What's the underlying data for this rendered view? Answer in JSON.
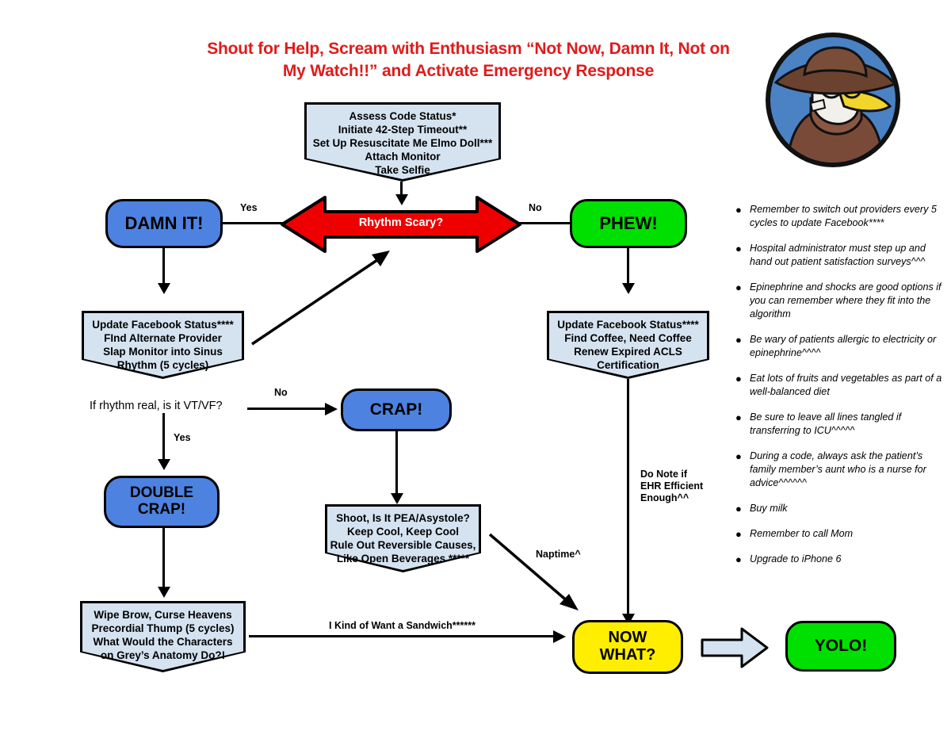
{
  "title": "Shout for Help, Scream with Enthusiasm “Not Now, Damn It,\nNot on My Watch!!” and Activate Emergency Response",
  "avatar": {
    "name": "plague-doctor-avatar",
    "background_color": "#4a82c4",
    "hat_color": "#6b4230",
    "robe_color": "#7a4a38",
    "mask_color": "#f2f2ee",
    "beak_color": "#f2d52a"
  },
  "colors": {
    "title_red": "#e01b1b",
    "arrow_red": "#ee0000",
    "node_blue": "#4d82e0",
    "node_green": "#00e000",
    "node_yellow": "#ffee00",
    "banner_fill": "#d5e3f1",
    "outline": "#000000"
  },
  "nodes": {
    "assess": "Assess Code Status*\nInitiate 42-Step Timeout**\nSet Up Resuscitate Me Elmo Doll***\nAttach Monitor\nTake Selfie",
    "damn_it": "DAMN IT!",
    "rhythm_scary": "Rhythm Scary?",
    "phew": "PHEW!",
    "update_fb_left": "Update Facebook Status****\nFInd Alternate Provider\nSlap Monitor into Sinus\nRhythm (5 cycles)",
    "update_fb_right": "Update Facebook Status****\nFind Coffee, Need Coffee\nRenew Expired ACLS\nCertification",
    "if_rhythm_real": "If rhythm real, is it VT/VF?",
    "crap": "CRAP!",
    "double_crap": "DOUBLE\nCRAP!",
    "pea_asystole": "Shoot, Is It PEA/Asystole?\nKeep Cool, Keep Cool\nRule Out Reversible Causes,\nLike Open Beverages *****",
    "wipe_brow": "Wipe Brow, Curse Heavens\nPrecordial Thump (5 cycles)\nWhat Would the Characters\non Grey’s Anatomy Do?!",
    "now_what": "NOW\nWHAT?",
    "yolo": "YOLO!"
  },
  "edge_labels": {
    "yes_left": "Yes",
    "no_right": "No",
    "no_vtvf": "No",
    "yes_vtvf": "Yes",
    "ehr": "Do Note if\nEHR Efficient\nEnough^^",
    "naptime": "Naptime^",
    "sandwich": "I Kind of Want a Sandwich******"
  },
  "bullets": [
    "Remember to switch out providers every 5 cycles to update Facebook****",
    "Hospital administrator must step up and hand out patient satisfaction surveys^^^",
    "Epinephrine and shocks are good options if you can remember where they fit into the algorithm",
    "Be wary of patients allergic to electricity or epinephrine^^^^",
    "Eat lots of fruits and vegetables as part of a well-balanced diet",
    "Be sure to leave all lines tangled if transferring to ICU^^^^^",
    "During a code, always ask the patient’s family member’s aunt who is a nurse for advice^^^^^^",
    "Buy milk",
    "Remember to call Mom",
    "Upgrade to iPhone 6"
  ],
  "bullet_glyph": "●"
}
